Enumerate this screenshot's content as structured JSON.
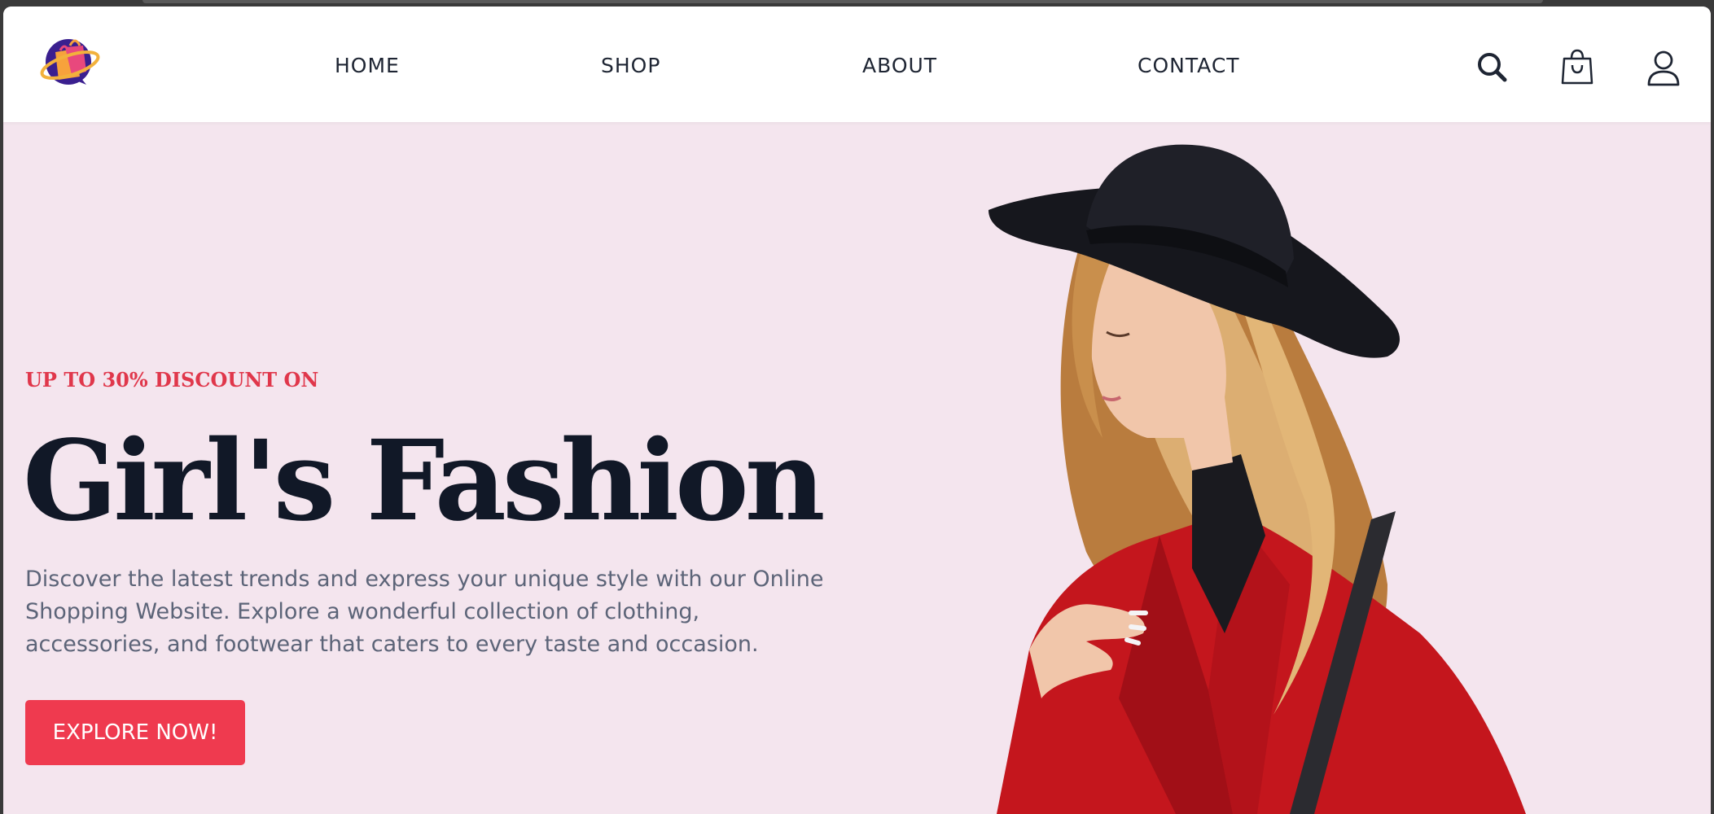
{
  "brand": {
    "logo_icon": "shopping-bags-globe-logo"
  },
  "nav": {
    "items": [
      {
        "label": "HOME"
      },
      {
        "label": "SHOP"
      },
      {
        "label": "ABOUT"
      },
      {
        "label": "CONTACT"
      }
    ]
  },
  "header_icons": {
    "search": "search-icon",
    "cart": "shopping-bag-icon",
    "account": "user-icon"
  },
  "hero": {
    "eyebrow": "UP TO 30% DISCOUNT ON",
    "title": "Girl's Fashion",
    "description": "Discover the latest trends and express your unique style with our Online Shopping Website. Explore a wonderful collection of clothing, accessories, and footwear that caters to every taste and occasion.",
    "cta_label": "EXPLORE NOW!"
  },
  "colors": {
    "accent": "#ef3a4f",
    "hero_background": "#f4e5ee",
    "heading": "#111827",
    "body_text": "#5c6478"
  }
}
